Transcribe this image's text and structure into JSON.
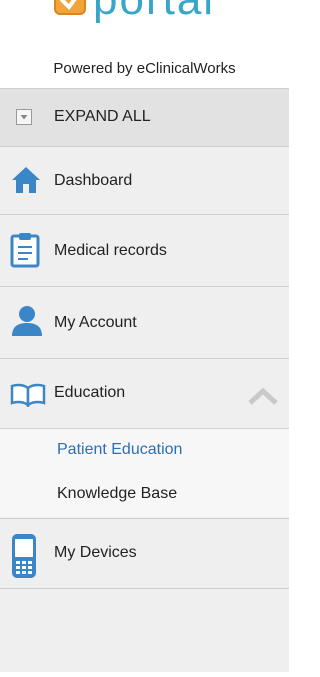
{
  "logo": {
    "text": "portal",
    "brand_color": "#38a6c8"
  },
  "powered_by": "Powered by eClinicalWorks",
  "expand_all": "EXPAND ALL",
  "nav": {
    "dashboard": "Dashboard",
    "medical_records": "Medical records",
    "my_account": "My Account",
    "education": "Education",
    "education_sub": [
      "Patient Education",
      "Knowledge Base"
    ],
    "my_devices": "My Devices"
  },
  "colors": {
    "icon_blue": "#3b86c6",
    "link_blue": "#2f6fb0",
    "sidebar_bg": "#efefef"
  }
}
